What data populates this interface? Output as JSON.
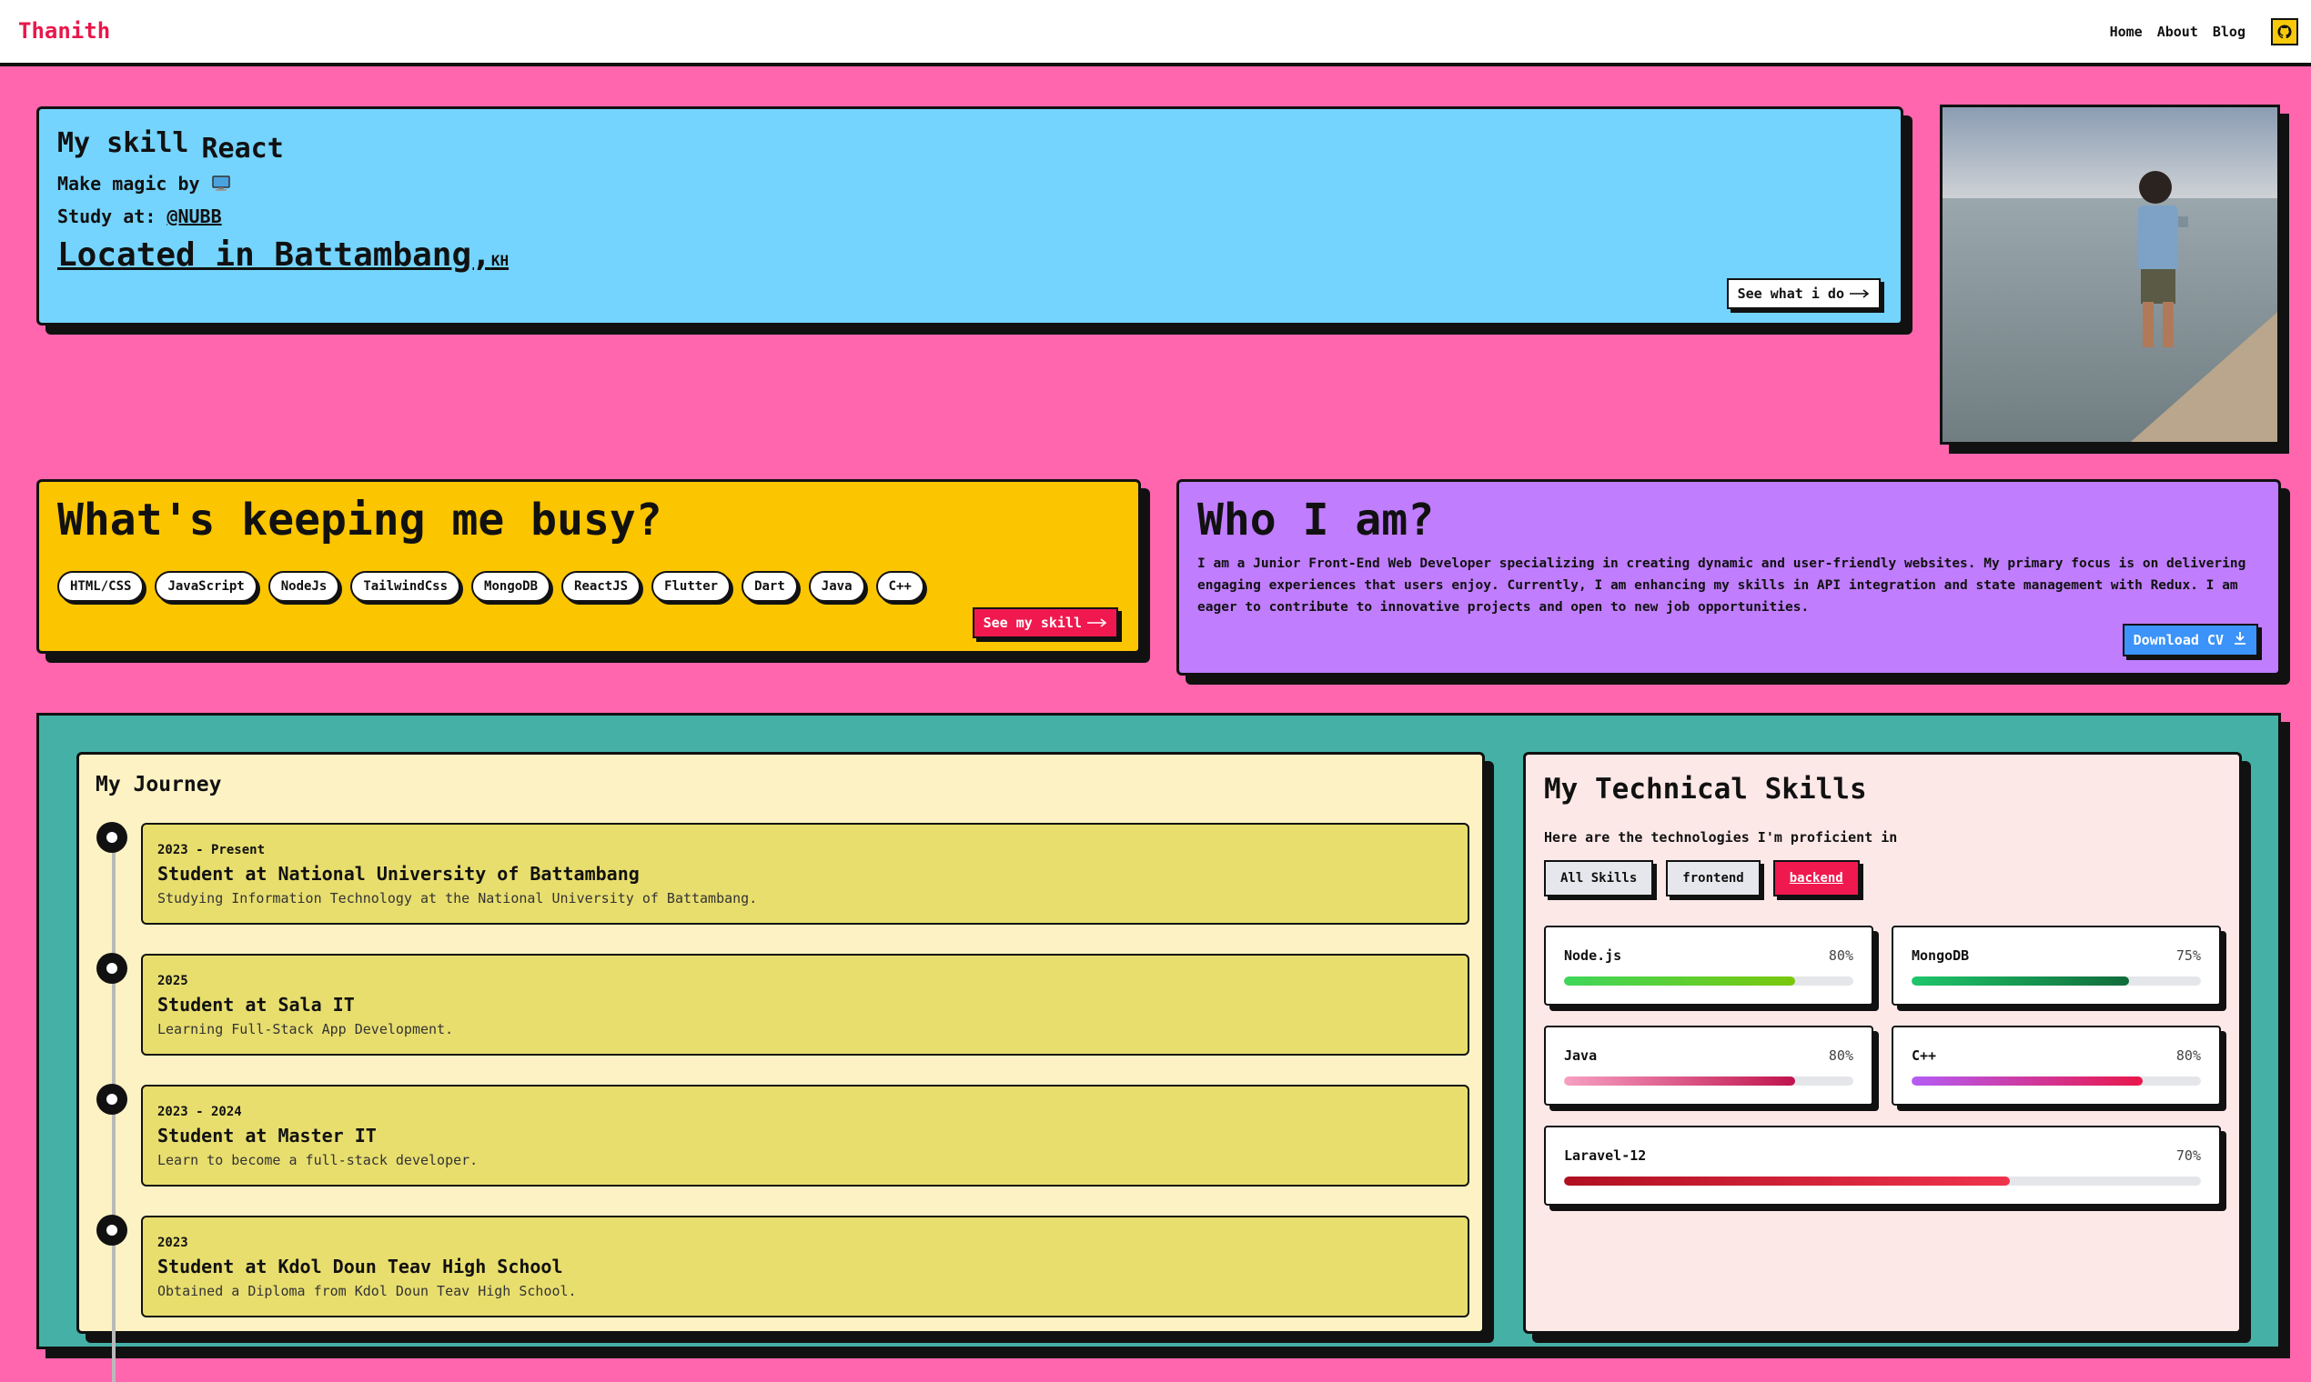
{
  "nav": {
    "brand": "Thanith",
    "links": [
      "Home",
      "About",
      "Blog"
    ]
  },
  "hero": {
    "title_prefix": "My skill",
    "title_rotating": "React",
    "magic_label": "Make magic by",
    "study_label": "Study at:",
    "study_school": "@NUBB",
    "location": "Located in Battambang,",
    "location_code": "KH",
    "cta": "See what i do"
  },
  "busy": {
    "title": "What's keeping me busy?",
    "tags": [
      "HTML/CSS",
      "JavaScript",
      "NodeJs",
      "TailwindCss",
      "MongoDB",
      "ReactJS",
      "Flutter",
      "Dart",
      "Java",
      "C++"
    ],
    "cta": "See my skill"
  },
  "who": {
    "title": "Who I am?",
    "description": "I am a Junior Front-End Web Developer specializing in creating dynamic and user-friendly websites. My primary focus is on delivering engaging experiences that users enjoy. Currently, I am enhancing my skills in API integration and state management with Redux. I am eager to contribute to innovative projects and open to new job opportunities.",
    "cta": "Download CV"
  },
  "journey": {
    "title": "My Journey",
    "items": [
      {
        "date": "2023 - Present",
        "role": "Student at National University of Battambang",
        "note": "Studying Information Technology at the National University of Battambang."
      },
      {
        "date": "2025",
        "role": "Student at Sala IT",
        "note": "Learning Full-Stack App Development."
      },
      {
        "date": "2023 - 2024",
        "role": "Student at Master IT",
        "note": "Learn to become a full-stack developer."
      },
      {
        "date": "2023",
        "role": "Student at Kdol Doun Teav High School",
        "note": "Obtained a Diploma from Kdol Doun Teav High School."
      }
    ]
  },
  "skills": {
    "title": "My Technical Skills",
    "subtitle": "Here are the technologies I'm proficient in",
    "filters": [
      "All Skills",
      "frontend",
      "backend"
    ],
    "active_filter": "backend",
    "items": [
      {
        "name": "Node.js",
        "percent": "80%",
        "value": 80,
        "color_from": "#3fd65a",
        "color_to": "#7ac70c"
      },
      {
        "name": "MongoDB",
        "percent": "75%",
        "value": 75,
        "color_from": "#1ec66a",
        "color_to": "#116b3b"
      },
      {
        "name": "Java",
        "percent": "80%",
        "value": 80,
        "color_from": "#f7a0c3",
        "color_to": "#c0134d"
      },
      {
        "name": "C++",
        "percent": "80%",
        "value": 80,
        "color_from": "#b45cf5",
        "color_to": "#e8174b"
      },
      {
        "name": "Laravel-12",
        "percent": "70%",
        "value": 70,
        "color_from": "#b01020",
        "color_to": "#f0334d"
      }
    ]
  },
  "colors": {
    "background": "#ff66ad",
    "hero": "#74d4fe",
    "busy": "#fbc500",
    "who": "#c07dfe",
    "teal": "#45b1a6",
    "accent_red": "#f0194f"
  }
}
